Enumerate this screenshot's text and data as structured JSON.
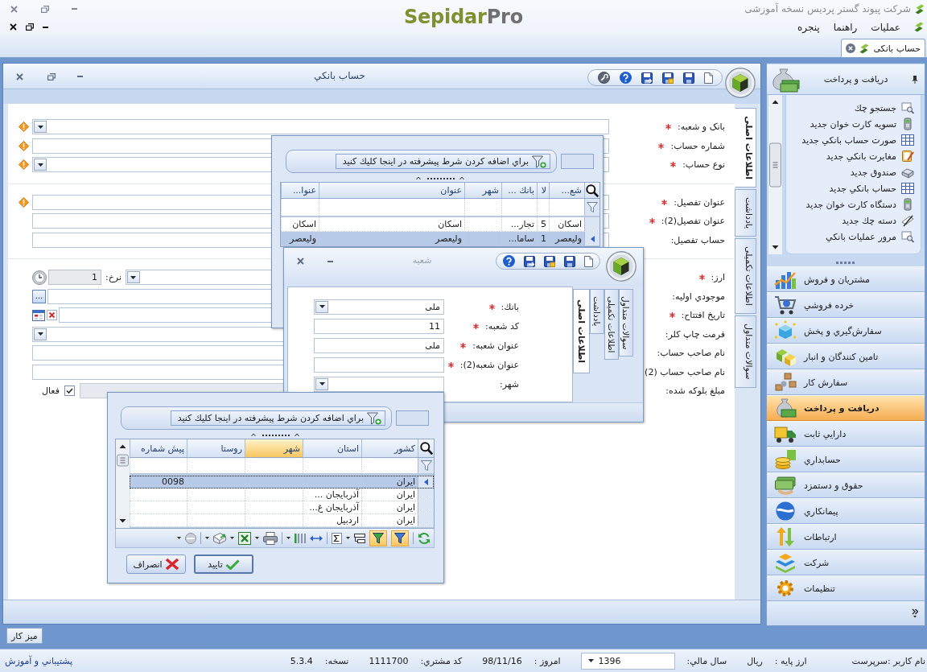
{
  "app": {
    "title": "شرکت پیوند گستر پردیس نسخه آموزشی",
    "logo": {
      "text": "Sepidar",
      "accent": "Pro"
    }
  },
  "menu": [
    {
      "label": "عملیات"
    },
    {
      "label": "راهنما"
    },
    {
      "label": "پنجره"
    }
  ],
  "doc_tabs": [
    {
      "label": "حساب بانکی",
      "selected": true
    }
  ],
  "form": {
    "title": "حساب بانکي",
    "tabs": [
      {
        "label": "اطلاعات اصلی",
        "selected": true
      },
      {
        "label": "یادداشت",
        "selected": false
      },
      {
        "label": "اطلاعات تکمیلی",
        "selected": false
      },
      {
        "label": "سوالات متداول",
        "selected": false
      }
    ],
    "sections": [
      {
        "fields": [
          {
            "kind": "dropdown",
            "label": "بانک و شعبه:",
            "required": true,
            "warning": true
          },
          {
            "kind": "text",
            "label": "شماره حساب:",
            "required": true,
            "warning": true
          },
          {
            "kind": "dropdown",
            "label": "نوع حساب:",
            "required": true,
            "warning": true
          }
        ]
      },
      {
        "fields": [
          {
            "kind": "text",
            "label": "عنوان تفصیل:",
            "required": true,
            "warning": true
          },
          {
            "kind": "text",
            "label": "عنوان تفصیل(2):",
            "required": true,
            "warning": false
          },
          {
            "kind": "text",
            "label": "حساب تفصیل:",
            "required": false,
            "warning": false
          }
        ]
      },
      {
        "fields": [
          {
            "kind": "currency",
            "label": "ارز:",
            "required": true,
            "warning": false,
            "rate_label": "نرخ:",
            "rate": "1"
          },
          {
            "kind": "lookup",
            "label": "موجودي اوليه:",
            "required": false,
            "warning": false,
            "button": "..."
          },
          {
            "kind": "date",
            "label": "تاريخ افتتاح:",
            "required": true,
            "warning": false
          },
          {
            "kind": "dropdown",
            "label": "فرمت چاپ کلر:",
            "required": false,
            "warning": false
          },
          {
            "kind": "text",
            "label": "نام صاحب حساب:",
            "required": false,
            "warning": false
          },
          {
            "kind": "text",
            "label": "نام صاحب حساب (2)",
            "required": false,
            "warning": false
          },
          {
            "kind": "amount",
            "label": "مبلغ بلوکه شده:",
            "required": false,
            "warning": false,
            "disabled": true,
            "option": {
              "label": "فعال",
              "checked": true
            }
          }
        ]
      }
    ]
  },
  "bank_lookup": {
    "filter_button": "براي اضافه کردن شرط پيشرفته در اينجا كليك كنيد",
    "columns": [
      {
        "label": "شع..."
      },
      {
        "label": "لا"
      },
      {
        "label": "بانك ..."
      },
      {
        "label": "شهر"
      },
      {
        "label": "عنوان"
      },
      {
        "label": "عنوا..."
      }
    ],
    "rows": [
      {
        "selected": false,
        "cells": [
          "اسکان",
          "5",
          "تجار...",
          null,
          "اسکان",
          "اسکان"
        ]
      },
      {
        "selected": true,
        "cells": [
          "وليعصر",
          "1",
          "ساما...",
          null,
          "وليعصر",
          "وليعصر"
        ]
      }
    ]
  },
  "branch_dialog": {
    "title": "شعبه",
    "tabs": [
      {
        "label": "اطلاعات اصلی",
        "selected": true
      },
      {
        "label": "یادداشت",
        "selected": false
      },
      {
        "label": "اطلاعات تکمیلی",
        "selected": false
      },
      {
        "label": "سوالات متداول",
        "selected": false
      }
    ],
    "fields": [
      {
        "kind": "dropdown",
        "label": "بانك:",
        "required": true,
        "value": "ملی"
      },
      {
        "kind": "text",
        "label": "کد شعبه:",
        "required": true,
        "value": "11"
      },
      {
        "kind": "text",
        "label": "عنوان شعبه:",
        "required": true,
        "value": "ملی"
      },
      {
        "kind": "text",
        "label": "عنوان شعبه(2):",
        "required": true
      },
      {
        "kind": "dropdown",
        "label": "شهر:",
        "required": false
      }
    ]
  },
  "city_lookup": {
    "filter_button": "براي اضافه کردن شرط پيشرفته در اينجا كليك كنيد",
    "columns": [
      {
        "label": "کشور",
        "highlighted": false
      },
      {
        "label": "استان",
        "highlighted": false
      },
      {
        "label": "شهر",
        "highlighted": true
      },
      {
        "label": "روستا",
        "highlighted": false
      },
      {
        "label": "پیش شماره",
        "highlighted": false
      }
    ],
    "rows": [
      {
        "selected": true,
        "cells": [
          "ایران",
          null,
          null,
          null,
          "0098"
        ]
      },
      {
        "selected": false,
        "cells": [
          "ایران",
          "آذربایجان ...",
          null,
          null,
          null
        ]
      },
      {
        "selected": false,
        "cells": [
          "ایران",
          "آذربایجان غ...",
          null,
          null,
          null
        ]
      },
      {
        "selected": false,
        "cells": [
          "ایران",
          "اردبیل",
          null,
          null,
          null
        ]
      }
    ],
    "filter_buttons": [
      {
        "on": true
      },
      {
        "on": true
      }
    ],
    "buttons": [
      {
        "kind": "ok",
        "label": "تایید"
      },
      {
        "kind": "cancel",
        "label": "انصراف"
      }
    ]
  },
  "sidebar": {
    "title": "دريافت و پرداخت",
    "items": [
      {
        "label": "جستجو چك"
      },
      {
        "label": "تسويه کارت خوان جديد"
      },
      {
        "label": "صورت حساب بانکي جديد"
      },
      {
        "label": "مغايرت بانکي جديد"
      },
      {
        "label": "صندوق جديد"
      },
      {
        "label": "حساب بانکي جديد"
      },
      {
        "label": "دستگاه کارت خوان جديد"
      },
      {
        "label": "دسته چك جديد"
      },
      {
        "label": "مرور عمليات بانکي"
      }
    ],
    "modules": [
      {
        "label": "مشتريان و فروش",
        "selected": false
      },
      {
        "label": "خرده فروشي",
        "selected": false
      },
      {
        "label": "سفارش‌گيري و پخش",
        "selected": false
      },
      {
        "label": "تامين كنندگان و انبار",
        "selected": false
      },
      {
        "label": "سفارش كار",
        "selected": false
      },
      {
        "label": "دريافت و پرداخت",
        "selected": true
      },
      {
        "label": "دارايي ثابت",
        "selected": false
      },
      {
        "label": "حسابداري",
        "selected": false
      },
      {
        "label": "حقوق و دستمزد",
        "selected": false
      },
      {
        "label": "پيمانكاري",
        "selected": false
      },
      {
        "label": "ارتباطات",
        "selected": false
      },
      {
        "label": "شركت",
        "selected": false
      },
      {
        "label": "تنظيمات",
        "selected": false
      }
    ]
  },
  "desk_button": "ميز كار",
  "status_bar": {
    "user": "نام کاربر :سرپرست",
    "fields": [
      {
        "kind": "text",
        "label": "ارز پایه :",
        "value": "ریال"
      },
      {
        "kind": "dropdown",
        "label": "سال مالي:",
        "value": "1396"
      },
      {
        "kind": "text",
        "label": "امروز :",
        "value": "98/11/16"
      },
      {
        "kind": "text",
        "label": "کد مشتري:",
        "value": "1111700"
      },
      {
        "kind": "text",
        "label": "نسخه:",
        "value": "5.3.4"
      }
    ],
    "link": "پشتيباني و آموزش"
  }
}
